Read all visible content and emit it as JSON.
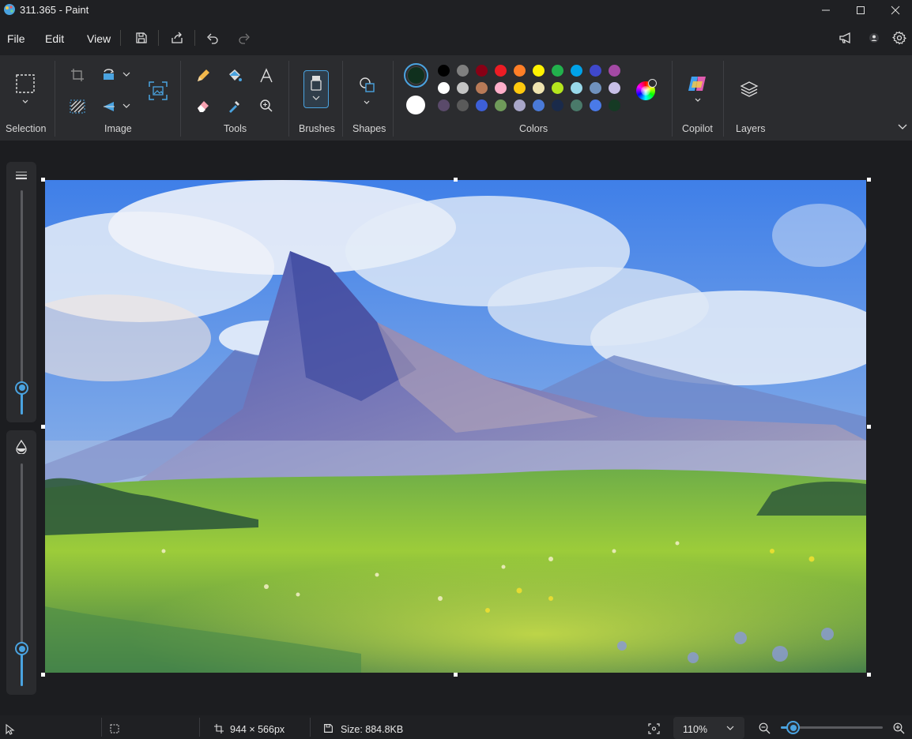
{
  "window": {
    "title": "311.365 - Paint"
  },
  "menu": {
    "file": "File",
    "edit": "Edit",
    "view": "View"
  },
  "ribbon": {
    "groups": {
      "selection": "Selection",
      "image": "Image",
      "tools": "Tools",
      "brushes": "Brushes",
      "shapes": "Shapes",
      "colors": "Colors",
      "copilot": "Copilot",
      "layers": "Layers"
    }
  },
  "colors": {
    "primary": "#10301e",
    "secondary": "#ffffff",
    "palette_row1": [
      "#000000",
      "#7f7f7f",
      "#880015",
      "#ed1c24",
      "#ff7f27",
      "#fff200",
      "#22b14c",
      "#00a2e8",
      "#3f48cc",
      "#a349a4"
    ],
    "palette_row2": [
      "#ffffff",
      "#c3c3c3",
      "#b97a57",
      "#ffaec9",
      "#ffc90e",
      "#efe4b0",
      "#b5e61d",
      "#99d9ea",
      "#7092be",
      "#c8bfe7"
    ],
    "palette_row3": [
      "#5a4a6a",
      "#5a5a5a",
      "#3d5fd8",
      "#6f9a5a",
      "#a8a6c8",
      "#4a7ad8",
      "#1a2a4a",
      "#4a7a6a",
      "#4a7ae8",
      "#153a24"
    ]
  },
  "status": {
    "dimensions": "944 × 566px",
    "size": "Size: 884.8KB",
    "zoom": "110%",
    "zoom_level": 0.12
  },
  "sliders": {
    "stroke_size_level": 0.12,
    "opacity_level": 0.17
  }
}
